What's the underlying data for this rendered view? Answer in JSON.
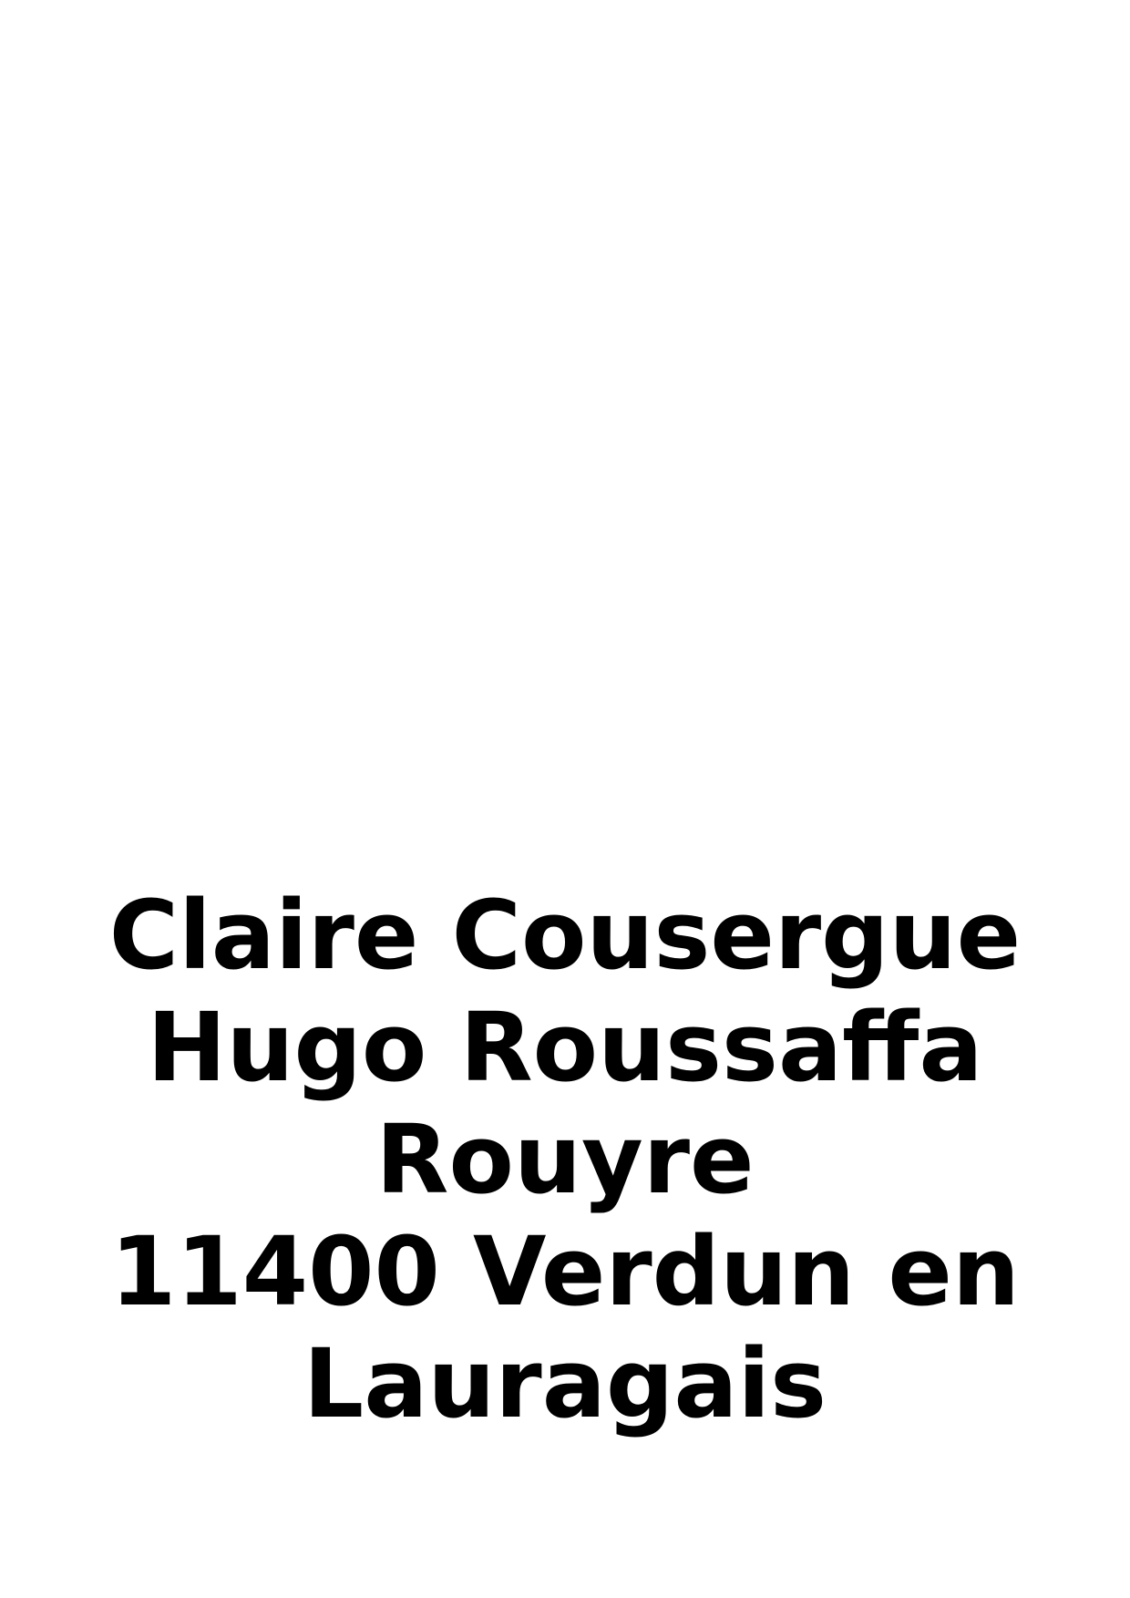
{
  "address": {
    "line1": "Claire Cousergue",
    "line2": "Hugo Roussaffa",
    "line3": "Rouyre",
    "line4": "11400 Verdun en",
    "line5": "Lauragais"
  },
  "colors": {
    "text": "#000000",
    "background": "#ffffff"
  }
}
